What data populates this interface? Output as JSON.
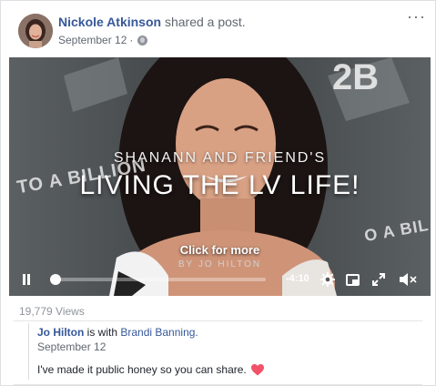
{
  "post": {
    "author": "Nickole Atkinson",
    "action": "shared a post.",
    "date": "September 12",
    "separator": "·",
    "privacy_icon": "globe-icon",
    "more_icon": "more-options-icon"
  },
  "video": {
    "overlay_subtitle": "SHANANN AND FRIEND'S",
    "overlay_title": "LIVING THE LV LIFE!",
    "click_prompt": "Click for more",
    "byline": "BY JO HILTON",
    "bg_text_left": "TO A BILLION",
    "bg_text_right": "2B",
    "bg_text_right2": "O A BIL",
    "time_remaining": "-4:10",
    "progress": 0.02,
    "controls": [
      "pause-icon",
      "gear-icon",
      "picture-in-picture-icon",
      "fullscreen-icon",
      "mute-icon"
    ]
  },
  "footer": {
    "views": "19,779 Views",
    "shared_author": "Jo Hilton",
    "is_with": "is with",
    "with_name": "Brandi Banning.",
    "shared_date": "September 12",
    "shared_text": "I've made it public honey so you can share.",
    "emoji": "heart-icon",
    "accent_color": "#365899",
    "heart_color": "#f25268"
  }
}
